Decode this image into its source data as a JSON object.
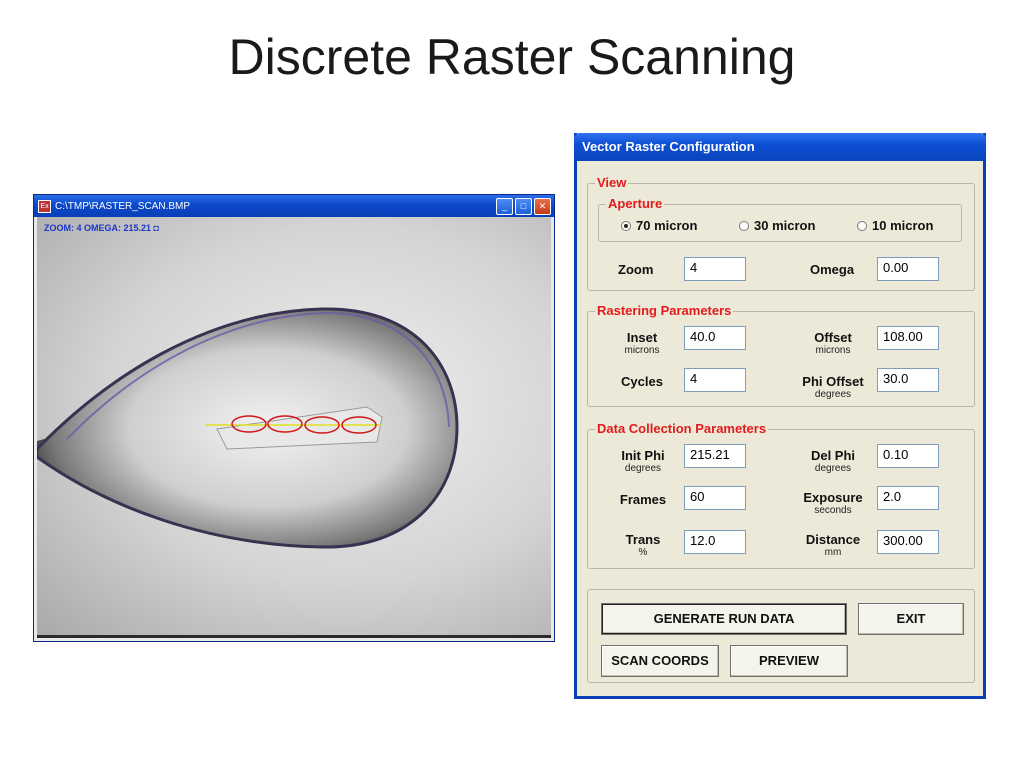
{
  "slide_title": "Discrete Raster Scanning",
  "image_window": {
    "title": "C:\\TMP\\RASTER_SCAN.BMP",
    "overlay_text": "ZOOM: 4  OMEGA: 215.21 ◘",
    "controls": {
      "minimize": "_",
      "maximize": "□",
      "close": "✕"
    },
    "app_icon": "Ex"
  },
  "dialog": {
    "title": "Vector Raster Configuration",
    "view": {
      "legend": "View",
      "aperture": {
        "legend": "Aperture",
        "options": [
          "70 micron",
          "30 micron",
          "10 micron"
        ],
        "selected": "70 micron"
      },
      "zoom_label": "Zoom",
      "zoom_value": "4",
      "omega_label": "Omega",
      "omega_value": "0.00"
    },
    "rastering": {
      "legend": "Rastering Parameters",
      "inset_label": "Inset",
      "inset_unit": "microns",
      "inset_value": "40.0",
      "offset_label": "Offset",
      "offset_unit": "microns",
      "offset_value": "108.00",
      "cycles_label": "Cycles",
      "cycles_value": "4",
      "phi_offset_label": "Phi Offset",
      "phi_offset_unit": "degrees",
      "phi_offset_value": "30.0"
    },
    "data_collection": {
      "legend": "Data Collection Parameters",
      "init_phi_label": "Init Phi",
      "init_phi_unit": "degrees",
      "init_phi_value": "215.21",
      "del_phi_label": "Del Phi",
      "del_phi_unit": "degrees",
      "del_phi_value": "0.10",
      "frames_label": "Frames",
      "frames_value": "60",
      "exposure_label": "Exposure",
      "exposure_unit": "seconds",
      "exposure_value": "2.0",
      "trans_label": "Trans",
      "trans_unit": "%",
      "trans_value": "12.0",
      "distance_label": "Distance",
      "distance_unit": "mm",
      "distance_value": "300.00"
    },
    "buttons": {
      "generate": "GENERATE RUN DATA",
      "exit": "EXIT",
      "scan_coords": "SCAN COORDS",
      "preview": "PREVIEW"
    }
  },
  "colors": {
    "legend_red": "#e21b1b",
    "titlebar_blue": "#0a44bd",
    "raster_ellipse": "#d01818",
    "raster_line": "#e0e020",
    "overlay_blue": "#1a36c8"
  }
}
